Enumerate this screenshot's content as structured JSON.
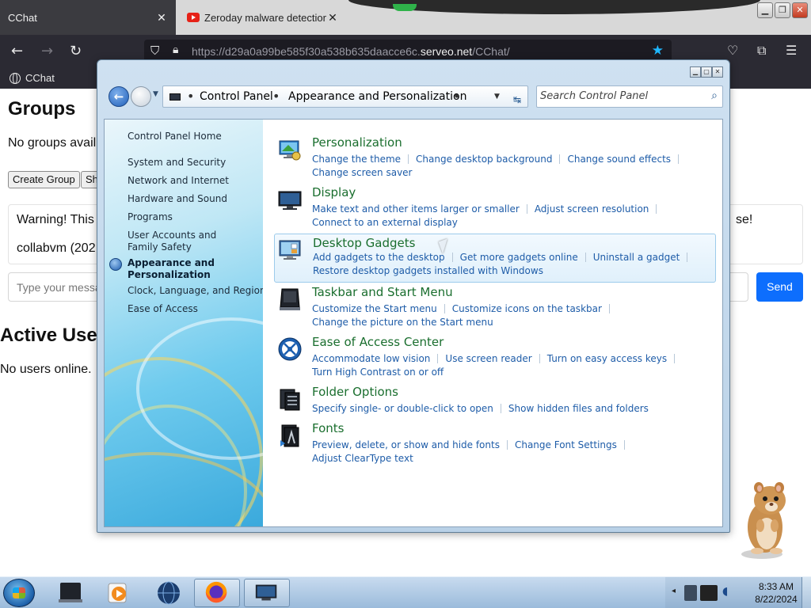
{
  "browser": {
    "tabs": [
      {
        "label": "CChat",
        "active": true
      },
      {
        "label": "Zeroday malware detection wi",
        "active": false
      }
    ],
    "url": {
      "prefix": "https://d29a0a99be585f30a538b635daacce6c.",
      "host": "serveo.net",
      "path": "/CChat/"
    },
    "bookmark": "CChat"
  },
  "page": {
    "groups_title": "Groups",
    "no_groups": "No groups avail",
    "create_group": "Create Group",
    "second_button": "Sh",
    "warning_line1": "Warning! This",
    "warning_line1_end": "se!",
    "warning_line2": "collabvm (202",
    "message_placeholder": "Type your messag",
    "send": "Send",
    "active_users_title": "Active Use",
    "no_users": "No users online."
  },
  "control_panel": {
    "breadcrumb": [
      "Control Panel",
      "Appearance and Personalization"
    ],
    "search_placeholder": "Search Control Panel",
    "sidebar": [
      {
        "label": "Control Panel Home"
      },
      {
        "label": "System and Security"
      },
      {
        "label": "Network and Internet"
      },
      {
        "label": "Hardware and Sound"
      },
      {
        "label": "Programs"
      },
      {
        "label": "User Accounts and Family Safety"
      },
      {
        "label": "Appearance and Personalization",
        "current": true
      },
      {
        "label": "Clock, Language, and Region"
      },
      {
        "label": "Ease of Access"
      }
    ],
    "categories": [
      {
        "title": "Personalization",
        "icon": "personalization-icon",
        "links": [
          "Change the theme",
          "Change desktop background",
          "Change sound effects",
          "Change screen saver"
        ]
      },
      {
        "title": "Display",
        "icon": "display-icon",
        "links": [
          "Make text and other items larger or smaller",
          "Adjust screen resolution",
          "Connect to an external display"
        ]
      },
      {
        "title": "Desktop Gadgets",
        "icon": "desktop-gadgets-icon",
        "highlighted": true,
        "links": [
          "Add gadgets to the desktop",
          "Get more gadgets online",
          "Uninstall a gadget",
          "Restore desktop gadgets installed with Windows"
        ]
      },
      {
        "title": "Taskbar and Start Menu",
        "icon": "taskbar-icon",
        "links": [
          "Customize the Start menu",
          "Customize icons on the taskbar",
          "Change the picture on the Start menu"
        ]
      },
      {
        "title": "Ease of Access Center",
        "icon": "ease-of-access-icon",
        "links": [
          "Accommodate low vision",
          "Use screen reader",
          "Turn on easy access keys",
          "Turn High Contrast on or off"
        ]
      },
      {
        "title": "Folder Options",
        "icon": "folder-options-icon",
        "links": [
          "Specify single- or double-click to open",
          "Show hidden files and folders"
        ]
      },
      {
        "title": "Fonts",
        "icon": "fonts-icon",
        "links": [
          "Preview, delete, or show and hide fonts",
          "Change Font Settings",
          "Adjust ClearType text"
        ]
      }
    ]
  },
  "taskbar": {
    "time": "8:33 AM",
    "date": "8/22/2024"
  },
  "colors": {
    "category_title": "#1a6e2e",
    "link": "#1e5ca8",
    "send_button": "#0d6efd",
    "firefox_dark": "#2b2a33"
  }
}
